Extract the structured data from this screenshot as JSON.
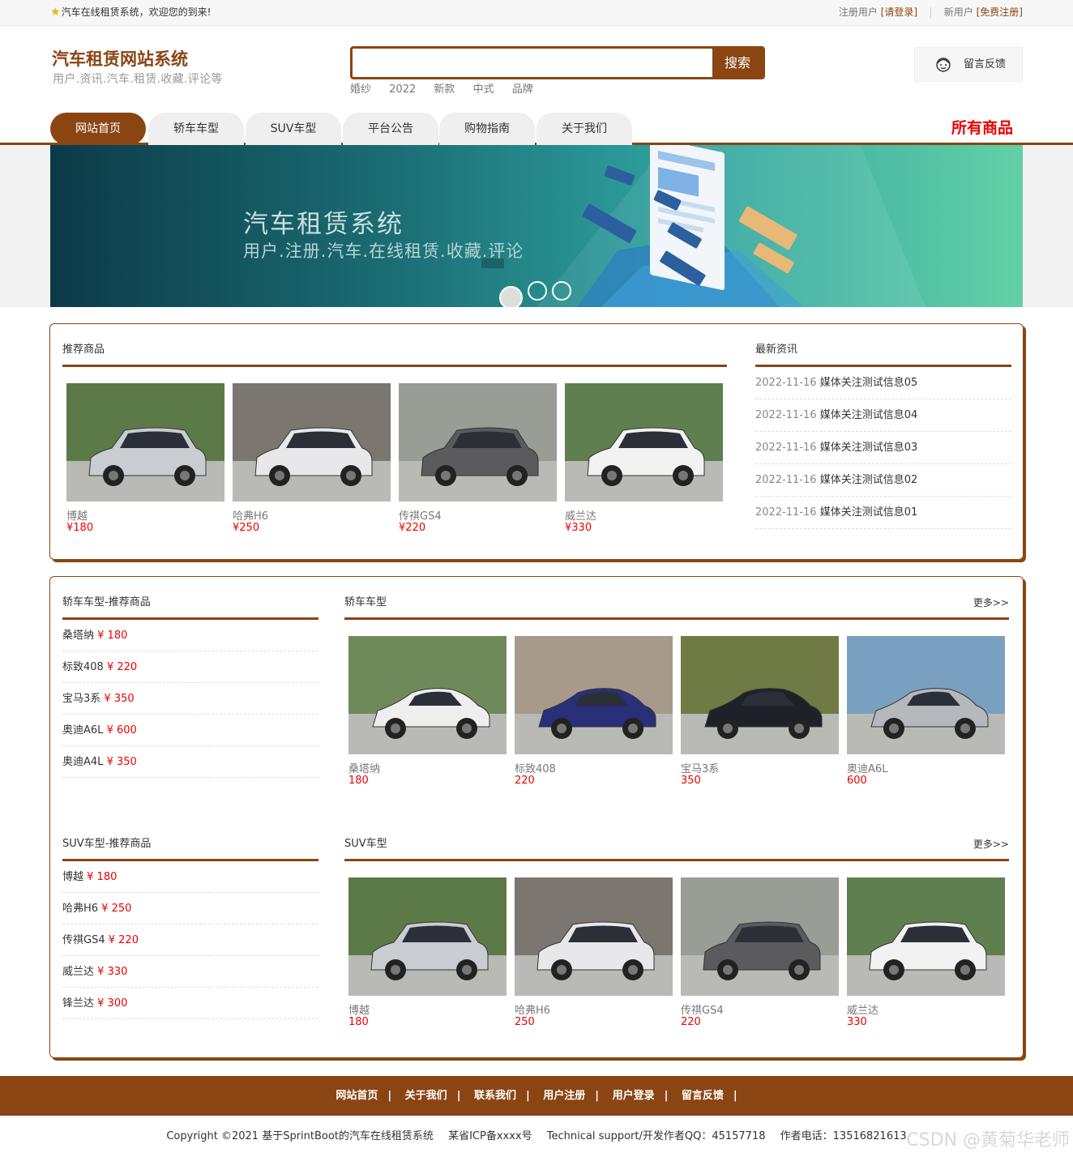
{
  "topbar": {
    "welcome": "汽车在线租赁系统，欢迎您的到来!",
    "register_user_label": "注册用户",
    "login_link": "[请登录]",
    "new_user_label": "新用户",
    "signup_link": "[免费注册]"
  },
  "header": {
    "site_title": "汽车租赁网站系统",
    "site_subtitle": "用户.资讯.汽车.租赁.收藏.评论等",
    "search_placeholder": "",
    "search_button": "搜索",
    "hot_tags": [
      "婚纱",
      "2022",
      "新款",
      "中式",
      "品牌"
    ],
    "feedback": "留言反馈"
  },
  "nav": {
    "tabs": [
      "网站首页",
      "轿车车型",
      "SUV车型",
      "平台公告",
      "购物指南",
      "关于我们"
    ],
    "all_products": "所有商品"
  },
  "banner": {
    "title": "汽车租赁系统",
    "subtitle": "用户.注册.汽车.在线租赁.收藏.评论",
    "active_slide": 1,
    "slide_count": 3,
    "colors": {
      "dark": "#0c3a48",
      "light": "#63d0a6"
    }
  },
  "recommended": {
    "title": "推荐商品",
    "items": [
      {
        "name": "博越",
        "price": "¥180",
        "car_color": "#c9ccd0",
        "bg": "#5c7a48"
      },
      {
        "name": "哈弗H6",
        "price": "¥250",
        "car_color": "#e8e8ea",
        "bg": "#7b7670"
      },
      {
        "name": "传祺GS4",
        "price": "¥220",
        "car_color": "#5b5b5e",
        "bg": "#9a9d96"
      },
      {
        "name": "威兰达",
        "price": "¥330",
        "car_color": "#f2f2f2",
        "bg": "#5f7f50"
      }
    ]
  },
  "news": {
    "title": "最新资讯",
    "items": [
      {
        "date": "2022-11-16",
        "title": "媒体关注测试信息05"
      },
      {
        "date": "2022-11-16",
        "title": "媒体关注测试信息04"
      },
      {
        "date": "2022-11-16",
        "title": "媒体关注测试信息03"
      },
      {
        "date": "2022-11-16",
        "title": "媒体关注测试信息02"
      },
      {
        "date": "2022-11-16",
        "title": "媒体关注测试信息01"
      }
    ]
  },
  "sedan_rec": {
    "title": "轿车车型-推荐商品",
    "items": [
      {
        "name": "桑塔纳",
        "price": "¥ 180"
      },
      {
        "name": "标致408",
        "price": "¥ 220"
      },
      {
        "name": "宝马3系",
        "price": "¥ 350"
      },
      {
        "name": "奥迪A6L",
        "price": "¥ 600"
      },
      {
        "name": "奥迪A4L",
        "price": "¥ 350"
      }
    ]
  },
  "sedan": {
    "title": "轿车车型",
    "more": "更多>>",
    "items": [
      {
        "name": "桑塔纳",
        "price": "180",
        "car_color": "#eeeeee",
        "bg": "#6f8a5a"
      },
      {
        "name": "标致408",
        "price": "220",
        "car_color": "#2a2f7a",
        "bg": "#a79a8a"
      },
      {
        "name": "宝马3系",
        "price": "350",
        "car_color": "#1e2228",
        "bg": "#6f7a45"
      },
      {
        "name": "奥迪A6L",
        "price": "600",
        "car_color": "#b5b8bd",
        "bg": "#7aa0c0"
      }
    ]
  },
  "suv_rec": {
    "title": "SUV车型-推荐商品",
    "items": [
      {
        "name": "博越",
        "price": "¥ 180"
      },
      {
        "name": "哈弗H6",
        "price": "¥ 250"
      },
      {
        "name": "传祺GS4",
        "price": "¥ 220"
      },
      {
        "name": "威兰达",
        "price": "¥ 330"
      },
      {
        "name": "锋兰达",
        "price": "¥ 300"
      }
    ]
  },
  "suv": {
    "title": "SUV车型",
    "more": "更多>>",
    "items": [
      {
        "name": "博越",
        "price": "180",
        "car_color": "#c9ccd0",
        "bg": "#5c7a48"
      },
      {
        "name": "哈弗H6",
        "price": "250",
        "car_color": "#e8e8ea",
        "bg": "#7b7670"
      },
      {
        "name": "传祺GS4",
        "price": "220",
        "car_color": "#5b5b5e",
        "bg": "#9a9d96"
      },
      {
        "name": "威兰达",
        "price": "330",
        "car_color": "#f2f2f2",
        "bg": "#5f7f50"
      }
    ]
  },
  "footer": {
    "links": [
      "网站首页",
      "关于我们",
      "联系我们",
      "用户注册",
      "用户登录",
      "留言反馈"
    ],
    "separator": "|",
    "copyright": "Copyright ©2021 基于SprintBoot的汽车在线租赁系统",
    "icp": "某省ICP备xxxx号",
    "support": "Technical support/开发作者QQ：45157718",
    "phone": "作者电话：13516821613"
  },
  "watermark": "CSDN @黄菊华老师"
}
